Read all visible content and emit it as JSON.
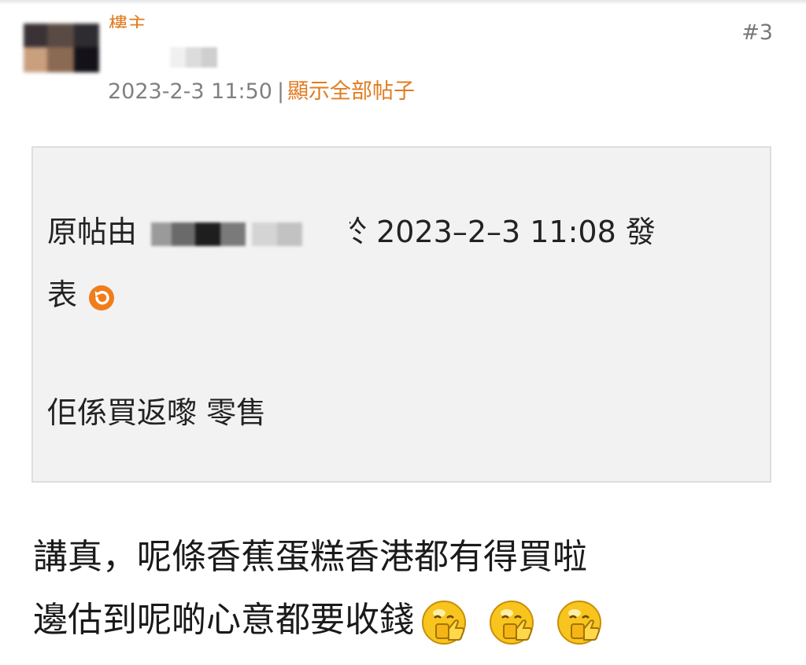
{
  "post": {
    "author_label": "樓主",
    "floor": "#3",
    "timestamp": "2023-2-3 11:50",
    "separator": "|",
    "show_all_posts": "顯示全部帖子"
  },
  "quote": {
    "prefix": "原帖由",
    "suffix_char": "於",
    "quoted_time": "2023–2–3 11:08 發",
    "line2": "表",
    "text": "佢係買返嚟 零售"
  },
  "reply": {
    "line1": "講真，呢條香蕉蛋糕香港都有得買啦",
    "line2": "邊估到呢啲心意都要收錢",
    "emoji_icon": "thumbs-up-smiley-icon",
    "emoji_count": 3
  },
  "colors": {
    "accent": "#e07c22",
    "meta_grey": "#808080",
    "quote_bg": "#f2f2f2"
  }
}
